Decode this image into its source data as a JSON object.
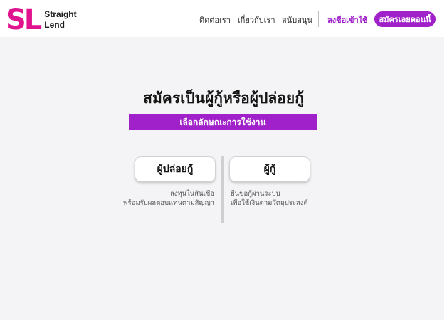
{
  "brand": {
    "mark": "SL",
    "name_line1": "Straight",
    "name_line2": "Lend",
    "accent_color": "#a020c9",
    "logo_color": "#e0148f"
  },
  "nav": {
    "contact": "ติดต่อเรา",
    "about": "เกี่ยวกับเรา",
    "support": "สนับสนุน",
    "login": "ลงชื่อเข้าใช้",
    "signup": "สมัครเลยตอนนี้"
  },
  "main": {
    "title": "สมัครเป็นผู้กู้หรือผู้ปล่อยกู้",
    "subtitle": "เลือกลักษณะการใช้งาน",
    "lender": {
      "label": "ผู้ปล่อยกู้",
      "desc_line1": "ลงทุนในสินเชื่อ",
      "desc_line2": "พร้อมรับผลตอบแทนตามสัญญา"
    },
    "borrower": {
      "label": "ผู้กู้",
      "desc_line1": "ยื่นขอกู้ผ่านระบบ",
      "desc_line2": "เพื่อใช้เงินตามวัตถุประสงค์"
    }
  }
}
